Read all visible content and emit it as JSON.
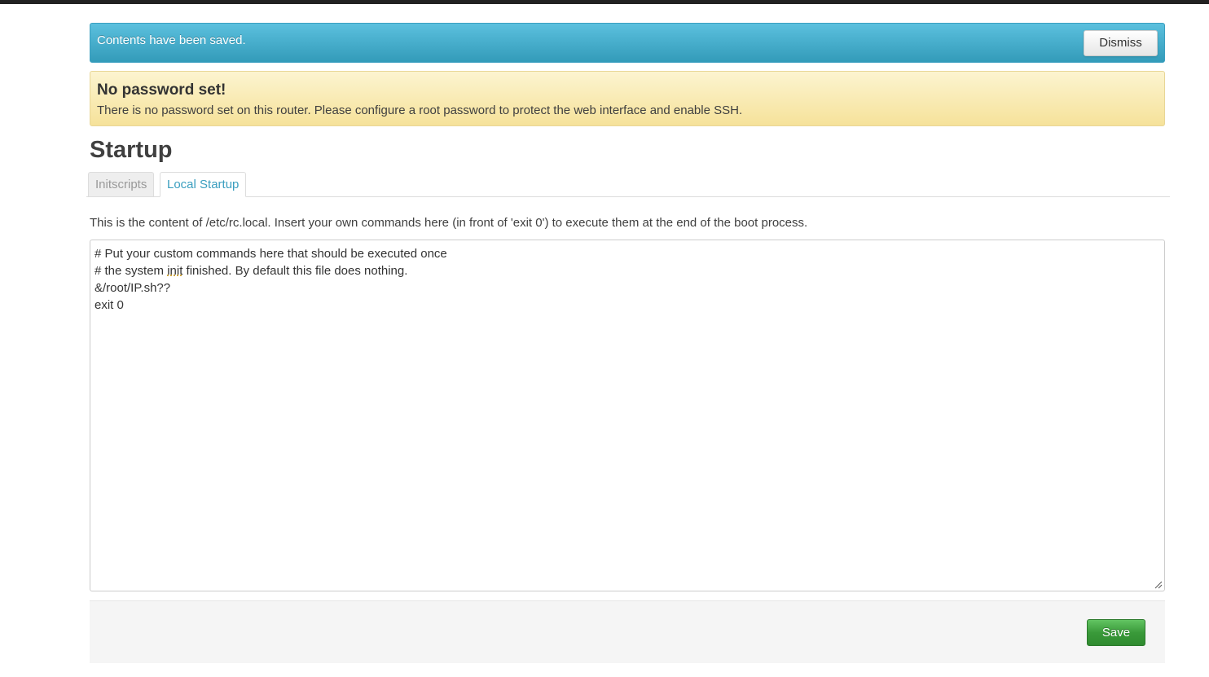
{
  "notification": {
    "message": "Contents have been saved.",
    "dismiss_label": "Dismiss"
  },
  "warning": {
    "title": "No password set!",
    "body": "There is no password set on this router. Please configure a root password to protect the web interface and enable SSH."
  },
  "page": {
    "title": "Startup"
  },
  "tabs": [
    {
      "label": "Initscripts",
      "active": false
    },
    {
      "label": "Local Startup",
      "active": true
    }
  ],
  "content": {
    "description": "This is the content of /etc/rc.local. Insert your own commands here (in front of 'exit 0') to execute them at the end of the boot process.",
    "editor_lines": [
      "# Put your custom commands here that should be executed once",
      "# the system init finished. By default this file does nothing.",
      "&/root/IP.sh??",
      "exit 0"
    ]
  },
  "actions": {
    "save_label": "Save"
  },
  "colors": {
    "info_alert": "#5bc0de",
    "warning_alert": "#f6e29a",
    "active_tab_text": "#3a9ebf",
    "save_button": "#3a9a3a"
  }
}
